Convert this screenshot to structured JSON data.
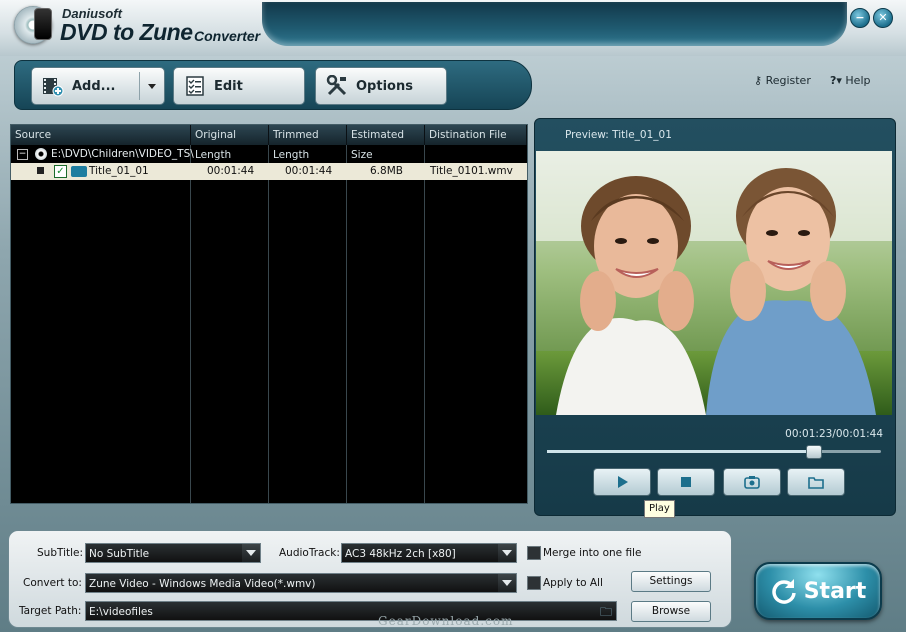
{
  "app": {
    "brand": "Daniusoft",
    "product": "DVD to Zune",
    "product_suffix": "Converter",
    "minimize_glyph": "−",
    "close_glyph": "✕"
  },
  "toolbar": {
    "add_label": "Add...",
    "edit_label": "Edit",
    "options_label": "Options",
    "register_label": "Register",
    "help_label": "Help"
  },
  "file_list": {
    "columns": [
      "Source",
      "Original Length",
      "Trimmed Length",
      "Estimated Size",
      "Distination File"
    ],
    "root_path": "E:\\DVD\\Children\\VIDEO_TS\\",
    "rows": [
      {
        "name": "Title_01_01",
        "original_length": "00:01:44",
        "trimmed_length": "00:01:44",
        "estimated_size": "6.8MB",
        "destination": "Title_0101.wmv",
        "checked": true
      }
    ]
  },
  "preview": {
    "label": "Preview: Title_01_01",
    "time": "00:01:23/00:01:44",
    "progress_fraction": 0.798,
    "tooltip": "Play"
  },
  "settings": {
    "subtitle_label": "SubTitle:",
    "subtitle_value": "No SubTitle",
    "audiotrack_label": "AudioTrack:",
    "audiotrack_value": "AC3 48kHz 2ch [x80]",
    "merge_label": "Merge into one file",
    "convert_label": "Convert to:",
    "convert_value": "Zune Video - Windows Media Video(*.wmv)",
    "apply_all_label": "Apply to All",
    "settings_button": "Settings",
    "target_label": "Target Path:",
    "target_value": "E:\\videofiles",
    "browse_button": "Browse"
  },
  "start_label": "Start",
  "watermark": "GearDownload.com",
  "colors": {
    "accent": "#1f5a70",
    "start_button": "#2d8fa9",
    "list_background": "#000000",
    "selected_row": "#ece9d8"
  }
}
